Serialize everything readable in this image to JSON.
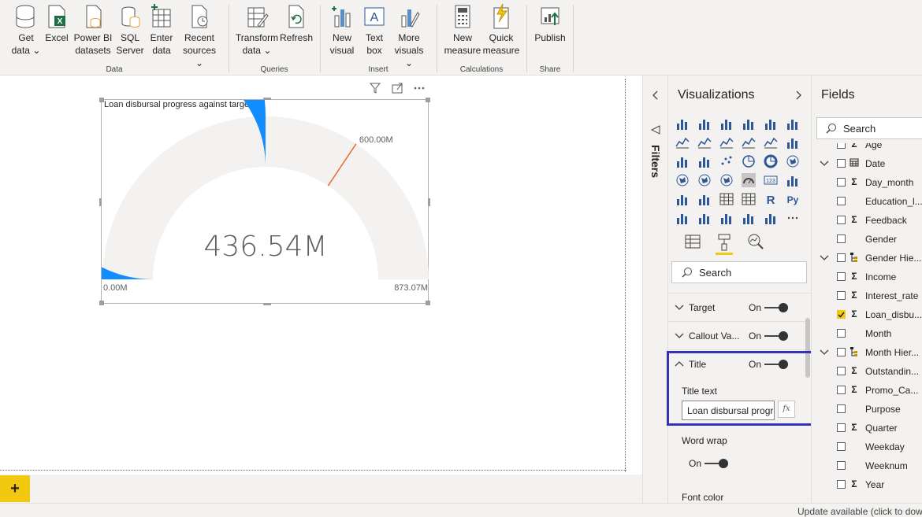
{
  "ribbon": {
    "groups": [
      {
        "name": "Data"
      },
      {
        "name": "Queries"
      },
      {
        "name": "Insert"
      },
      {
        "name": "Calculations"
      },
      {
        "name": "Share"
      }
    ],
    "buttons": [
      {
        "line1": "Get",
        "line2": "data ⌄",
        "icon": "database-icon"
      },
      {
        "line1": "Excel",
        "line2": "",
        "icon": "excel-icon"
      },
      {
        "line1": "Power BI",
        "line2": "datasets",
        "icon": "dataset-icon"
      },
      {
        "line1": "SQL",
        "line2": "Server",
        "icon": "sql-server-icon"
      },
      {
        "line1": "Enter",
        "line2": "data",
        "icon": "table-add-icon"
      },
      {
        "line1": "Recent",
        "line2": "sources ⌄",
        "icon": "recent-sources-icon"
      },
      {
        "line1": "Transform",
        "line2": "data ⌄",
        "icon": "transform-icon"
      },
      {
        "line1": "Refresh",
        "line2": "",
        "icon": "refresh-icon"
      },
      {
        "line1": "New",
        "line2": "visual",
        "icon": "new-visual-icon"
      },
      {
        "line1": "Text",
        "line2": "box",
        "icon": "text-box-icon"
      },
      {
        "line1": "More",
        "line2": "visuals ⌄",
        "icon": "more-visuals-icon"
      },
      {
        "line1": "New",
        "line2": "measure",
        "icon": "calculator-icon"
      },
      {
        "line1": "Quick",
        "line2": "measure",
        "icon": "quick-measure-icon"
      },
      {
        "line1": "Publish",
        "line2": "",
        "icon": "publish-icon"
      }
    ]
  },
  "visual": {
    "title": "Loan disbursal progress against target",
    "value_label": "436.54M",
    "min_label": "0.00M",
    "max_label": "873.07M",
    "target_label": "600.00M"
  },
  "chart_data": {
    "type": "gauge",
    "title": "Loan disbursal progress against target",
    "value": 436.54,
    "min": 0,
    "max": 873.07,
    "target": 600,
    "unit": "M",
    "fill_color": "#118dff",
    "track_color": "#f3f2f1",
    "target_color": "#e66c37"
  },
  "filters": {
    "label": "Filters"
  },
  "visualizations": {
    "title": "Visualizations",
    "search_placeholder": "Search",
    "properties": [
      {
        "label": "Target",
        "state": "On"
      },
      {
        "label": "Callout Va...",
        "state": "On"
      },
      {
        "label": "Title",
        "state": "On"
      }
    ],
    "title_text_label": "Title text",
    "title_text_value": "Loan disbursal progress against target",
    "fx_label": "fx",
    "word_wrap_label": "Word wrap",
    "word_wrap_state": "On",
    "font_color_label": "Font color"
  },
  "fields": {
    "title": "Fields",
    "search_placeholder": "Search",
    "items": [
      {
        "name": "Age",
        "type": "sigma",
        "checked": false,
        "expand": false
      },
      {
        "name": "Date",
        "type": "calendar",
        "checked": false,
        "expand": true
      },
      {
        "name": "Day_month",
        "type": "sigma",
        "checked": false,
        "expand": false
      },
      {
        "name": "Education_l...",
        "type": "",
        "checked": false,
        "expand": false
      },
      {
        "name": "Feedback",
        "type": "sigma",
        "checked": false,
        "expand": false
      },
      {
        "name": "Gender",
        "type": "",
        "checked": false,
        "expand": false
      },
      {
        "name": "Gender Hie...",
        "type": "hierarchy",
        "checked": false,
        "expand": true
      },
      {
        "name": "Income",
        "type": "sigma",
        "checked": false,
        "expand": false
      },
      {
        "name": "Interest_rate",
        "type": "sigma",
        "checked": false,
        "expand": false
      },
      {
        "name": "Loan_disbu...",
        "type": "sigma",
        "checked": true,
        "expand": false
      },
      {
        "name": "Month",
        "type": "",
        "checked": false,
        "expand": false
      },
      {
        "name": "Month Hier...",
        "type": "hierarchy",
        "checked": false,
        "expand": true
      },
      {
        "name": "Outstandin...",
        "type": "sigma",
        "checked": false,
        "expand": false
      },
      {
        "name": "Promo_Ca...",
        "type": "sigma",
        "checked": false,
        "expand": false
      },
      {
        "name": "Purpose",
        "type": "",
        "checked": false,
        "expand": false
      },
      {
        "name": "Quarter",
        "type": "sigma",
        "checked": false,
        "expand": false
      },
      {
        "name": "Weekday",
        "type": "",
        "checked": false,
        "expand": false
      },
      {
        "name": "Weeknum",
        "type": "",
        "checked": false,
        "expand": false
      },
      {
        "name": "Year",
        "type": "sigma",
        "checked": false,
        "expand": false
      }
    ]
  },
  "status": {
    "text": "Update available (click to dow"
  },
  "pages": {
    "add_label": "+"
  }
}
